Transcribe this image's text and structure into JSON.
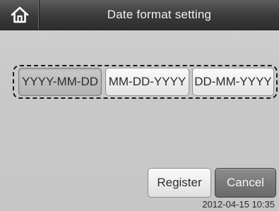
{
  "header": {
    "home_icon": "home-icon",
    "title": "Date format setting"
  },
  "date_formats": {
    "selected_index": 0,
    "options": [
      {
        "label": "YYYY-MM-DD"
      },
      {
        "label": "MM-DD-YYYY"
      },
      {
        "label": "DD-MM-YYYY"
      }
    ]
  },
  "actions": {
    "register_label": "Register",
    "cancel_label": "Cancel"
  },
  "status": {
    "datetime": "2012-04-15 10:35"
  },
  "colors": {
    "title_bar": "#3a3a3a",
    "background": "#c9c9c9",
    "selected_option": "#bcbcbc",
    "cancel_button": "#777777"
  }
}
